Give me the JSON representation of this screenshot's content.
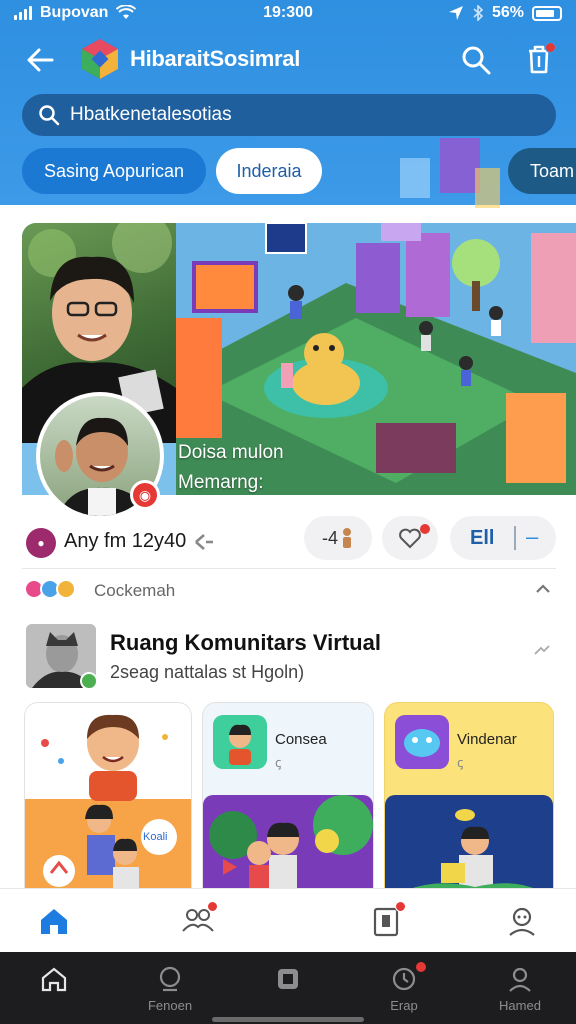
{
  "status_bar": {
    "carrier": "Bupovan",
    "time": "19:300",
    "battery": "56%"
  },
  "header": {
    "title": "HibaraitSosimral",
    "search_placeholder": "Hbatkenetalesotias",
    "chips": [
      "Sasing Aopurican",
      "Inderaia",
      "Toam"
    ]
  },
  "hero": {
    "caption_line1": "Doisa mulon",
    "caption_line2": "Memarng:"
  },
  "post_actions": {
    "author_line": "Any fm 12y40",
    "reaction_count": "-4",
    "extra_label": "Ell",
    "extra_minus": "–"
  },
  "reactions": {
    "label": "Cockemah"
  },
  "community": {
    "title": "Ruang Komunitars Virtual",
    "subtitle": "2seag nattalas st Hgoln)",
    "cards": [
      {
        "label": "",
        "bubble": "Koali"
      },
      {
        "label": "Consea",
        "sub": "ꞔ"
      },
      {
        "label": "Vindenar",
        "sub": "ꞔ"
      }
    ]
  },
  "bottom_tabs": {
    "items": [
      "",
      "Fenoen",
      "",
      "Erap",
      "Hamed"
    ]
  },
  "colors": {
    "header_blue": "#2f8fe0",
    "search_bg": "#1f5f9e",
    "accent_red": "#e53935",
    "dark_bar": "#1d1d1f"
  }
}
